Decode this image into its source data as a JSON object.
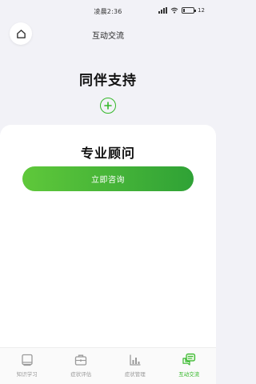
{
  "status_bar": {
    "time": "凌晨2:36",
    "battery": "12",
    "battery_level": 0.12
  },
  "nav": {
    "title": "互动交流",
    "home_icon": "home-icon"
  },
  "peer_support": {
    "title": "同伴支持",
    "add_icon": "plus-icon"
  },
  "consult": {
    "title": "专业顾问",
    "button_label": "立即咨询"
  },
  "tabs": [
    {
      "label": "知识学习",
      "icon": "book-icon",
      "active": false
    },
    {
      "label": "症状评估",
      "icon": "briefcase-icon",
      "active": false
    },
    {
      "label": "症状管理",
      "icon": "chart-icon",
      "active": false
    },
    {
      "label": "互动交流",
      "icon": "chat-icon",
      "active": true
    }
  ],
  "colors": {
    "accent": "#35b82a",
    "background": "#f2f2f7",
    "card": "#ffffff",
    "inactive": "#9a9a9a"
  }
}
